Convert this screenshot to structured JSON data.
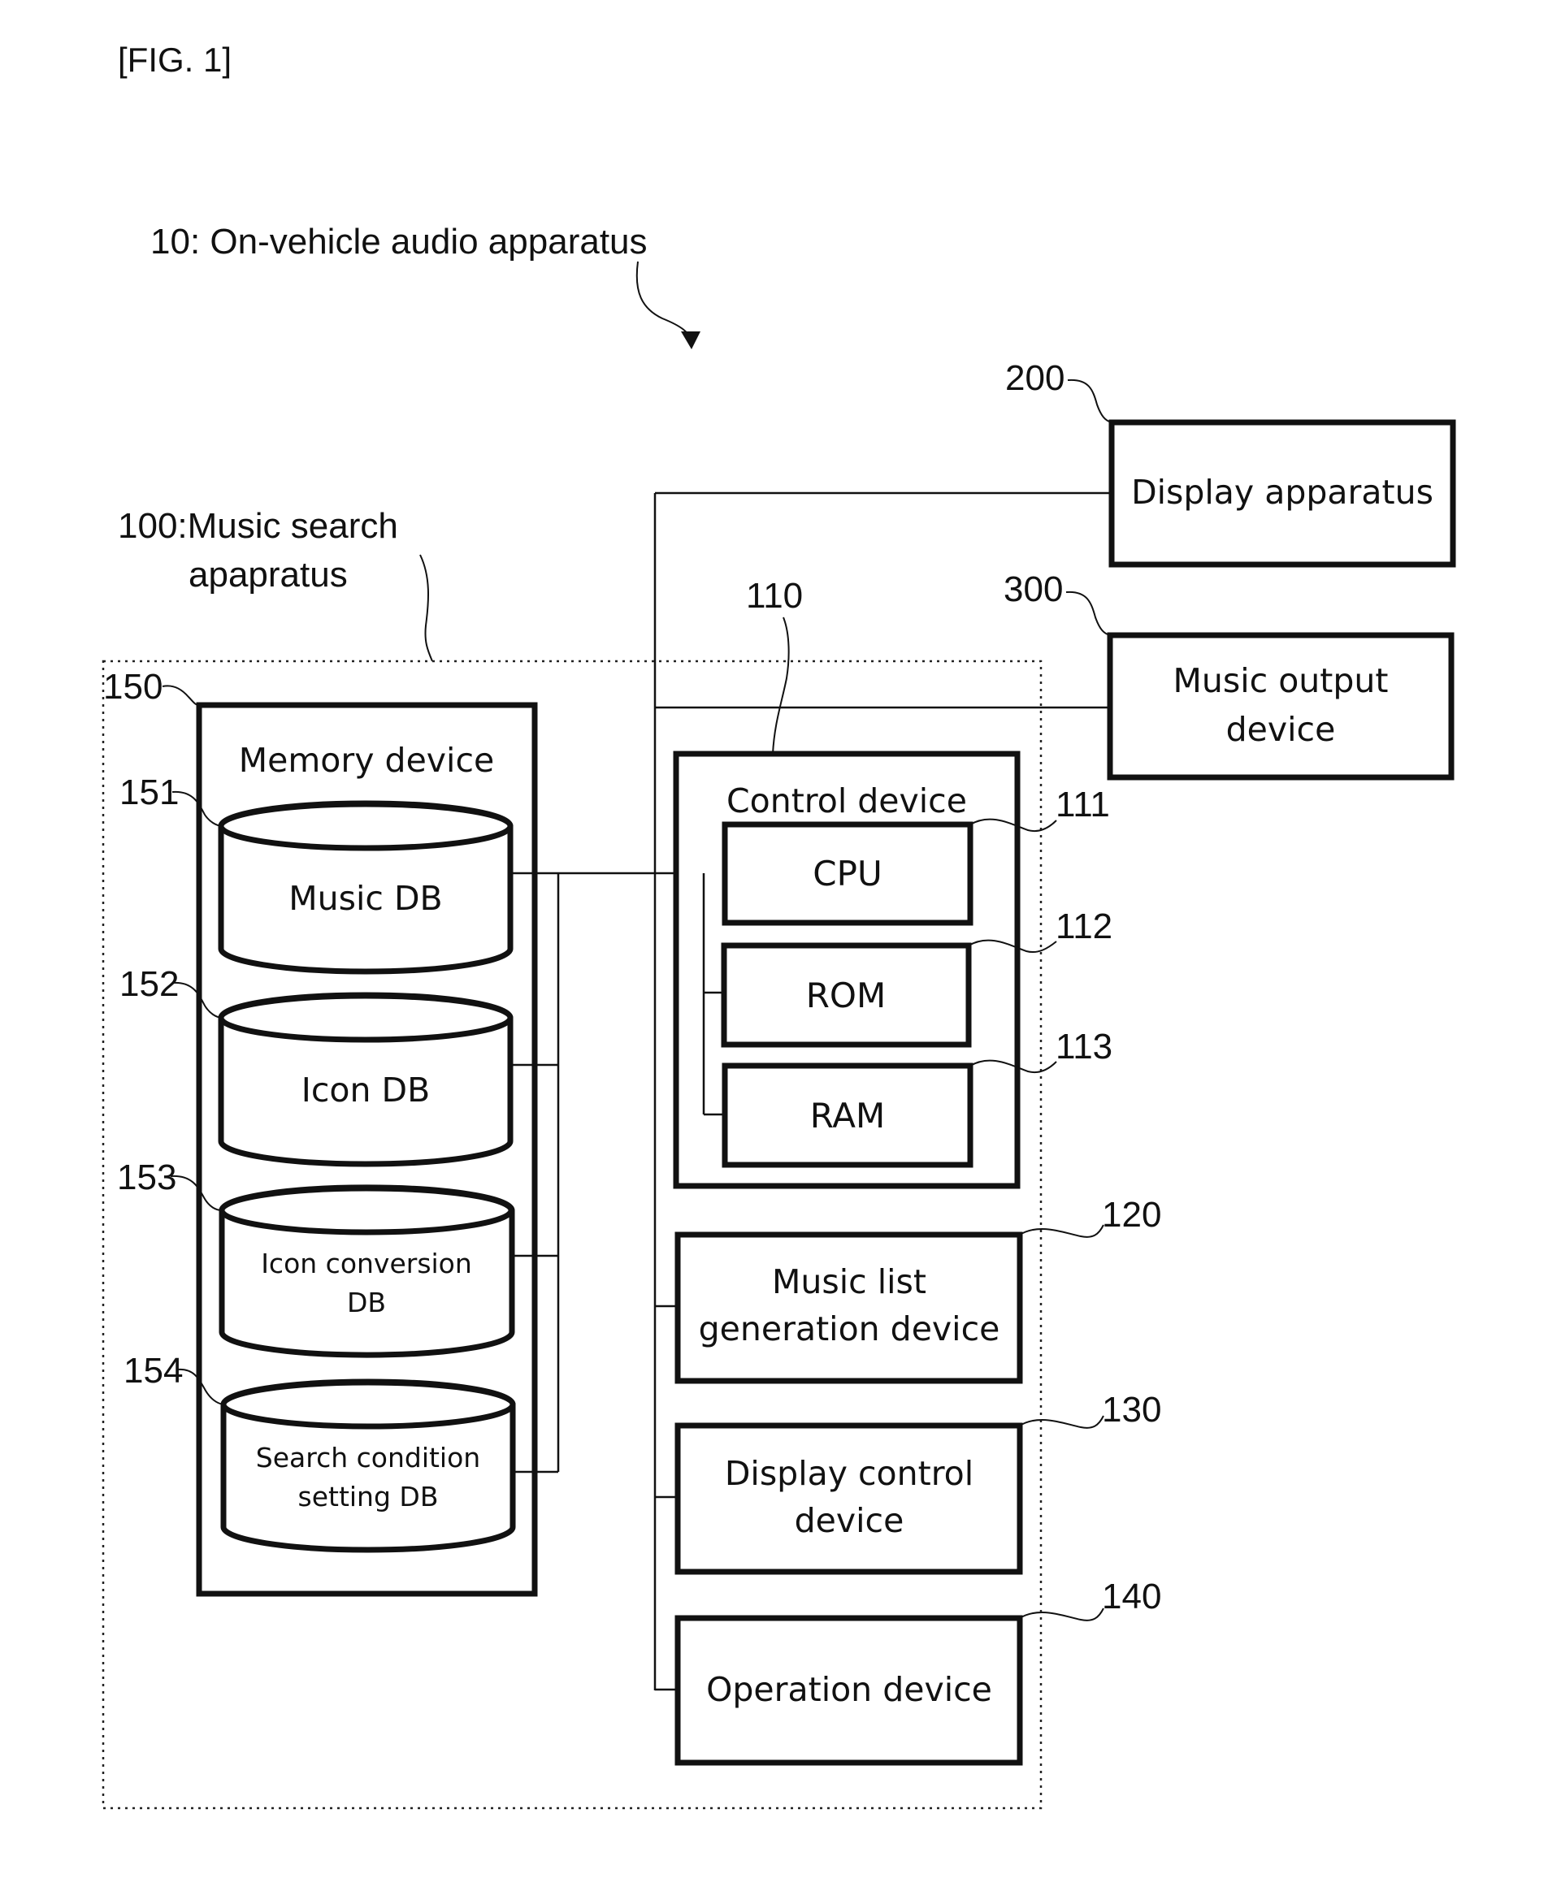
{
  "figure_label": "[FIG. 1]",
  "system": {
    "ref": "10",
    "label": "10: On-vehicle audio apparatus"
  },
  "apparatus": {
    "ref": "100",
    "label_line1": "100:Music search",
    "label_line2": "apapratus"
  },
  "external_devices": [
    {
      "ref": "200",
      "line1": "Display apparatus",
      "line2": ""
    },
    {
      "ref": "300",
      "line1": "Music output",
      "line2": "device"
    }
  ],
  "memory_device": {
    "ref": "150",
    "label": "Memory device",
    "databases": [
      {
        "ref": "151",
        "line1": "Music DB",
        "line2": ""
      },
      {
        "ref": "152",
        "line1": "Icon DB",
        "line2": ""
      },
      {
        "ref": "153",
        "line1": "Icon conversion",
        "line2": "DB"
      },
      {
        "ref": "154",
        "line1": "Search condition",
        "line2": "setting DB"
      }
    ]
  },
  "control_device": {
    "ref": "110",
    "label": "Control device",
    "components": [
      {
        "ref": "111",
        "label": "CPU"
      },
      {
        "ref": "112",
        "label": "ROM"
      },
      {
        "ref": "113",
        "label": "RAM"
      }
    ]
  },
  "other_devices": [
    {
      "ref": "120",
      "line1": "Music list",
      "line2": "generation device"
    },
    {
      "ref": "130",
      "line1": "Display control",
      "line2": "device"
    },
    {
      "ref": "140",
      "line1": "Operation device",
      "line2": ""
    }
  ]
}
